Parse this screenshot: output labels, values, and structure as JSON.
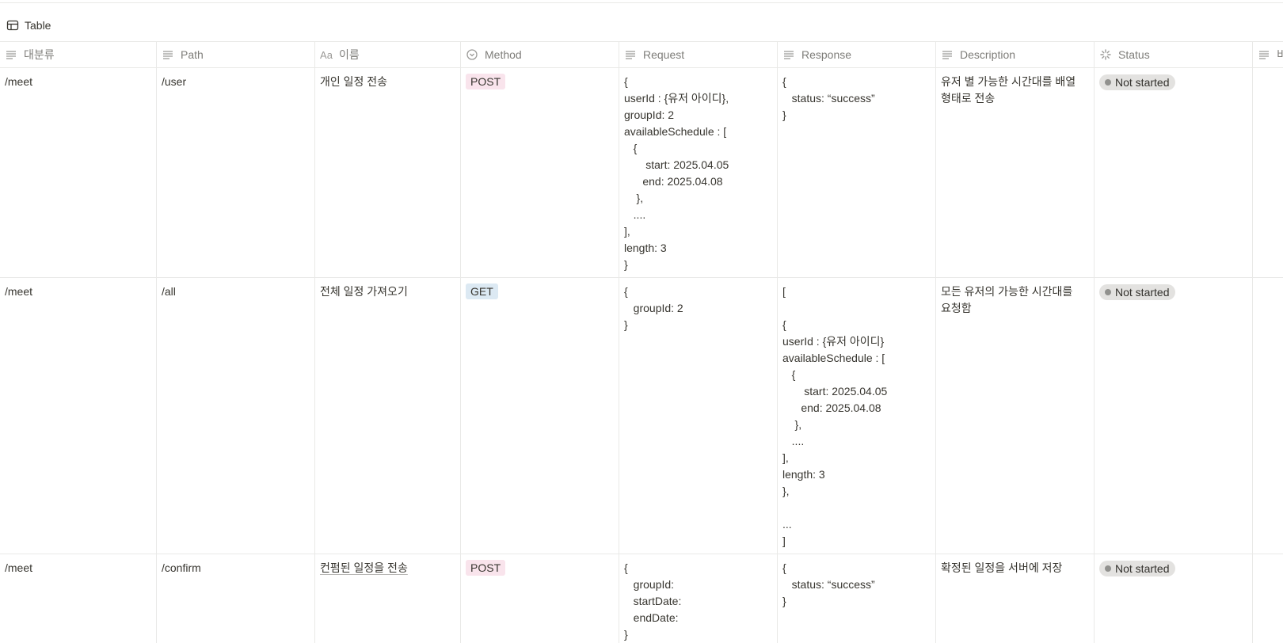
{
  "view": {
    "label": "Table",
    "icon": "table-icon"
  },
  "columns": [
    {
      "label": "대분류",
      "icon": "text-lines-icon"
    },
    {
      "label": "Path",
      "icon": "text-lines-icon"
    },
    {
      "label": "이름",
      "icon": "title-aa-icon",
      "icon_text": "Aa"
    },
    {
      "label": "Method",
      "icon": "select-circle-icon"
    },
    {
      "label": "Request",
      "icon": "text-lines-icon"
    },
    {
      "label": "Response",
      "icon": "text-lines-icon"
    },
    {
      "label": "Description",
      "icon": "text-lines-icon"
    },
    {
      "label": "Status",
      "icon": "status-loader-icon"
    },
    {
      "label": "비",
      "icon": "text-lines-icon"
    }
  ],
  "rows": [
    {
      "category": "/meet",
      "path": "/user",
      "name": "개인 일정 전송",
      "method": "POST",
      "request": "{\nuserId : {유저 아이디},\ngroupId: 2\navailableSchedule : [\n   {\n       start: 2025.04.05\n      end: 2025.04.08\n    },\n   ....\n],\nlength: 3\n}",
      "response": "{\n   status: “success”\n}",
      "description": "유저 별 가능한 시간대를 배열 형태로 전송",
      "status": "Not started"
    },
    {
      "category": "/meet",
      "path": "/all",
      "name": "전체 일정 가져오기",
      "method": "GET",
      "request": "{\n   groupId: 2\n}",
      "response": "[\n\n{\nuserId : {유저 아이디}\navailableSchedule : [\n   {\n       start: 2025.04.05\n      end: 2025.04.08\n    },\n   ....\n],\nlength: 3\n},\n\n...\n]",
      "description": "모든 유저의 가능한 시간대를 요청함",
      "status": "Not started"
    },
    {
      "category": "/meet",
      "path": "/confirm",
      "name": "컨펌된 일정을 전송",
      "method": "POST",
      "request": "{\n   groupId:\n   startDate:\n   endDate:\n}",
      "response": "{\n   status: “success”\n}",
      "description": "확정된 일정을 서버에 저장",
      "status": "Not started"
    }
  ],
  "colors": {
    "post_tag": "#f9e4ec",
    "get_tag": "#dce9f3",
    "status_bg": "#e3e2e0",
    "status_dot": "#91918e",
    "border": "#e9e9e7"
  }
}
